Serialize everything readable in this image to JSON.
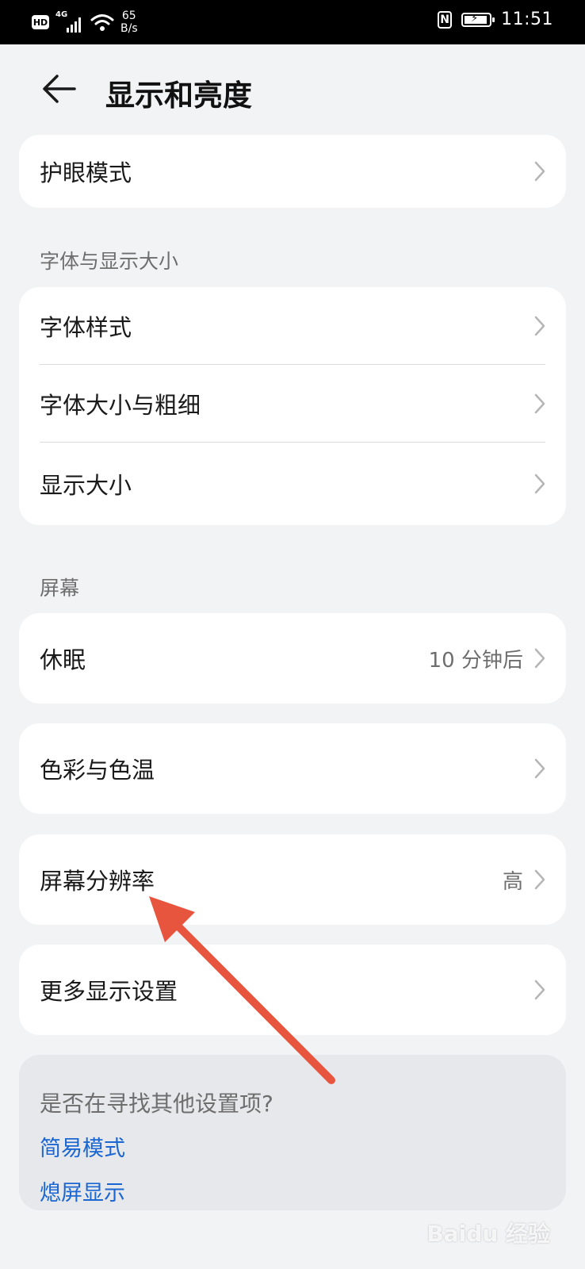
{
  "status_bar": {
    "hd": "HD",
    "network": "4G",
    "speed_value": "65",
    "speed_unit": "B/s",
    "nfc": "N",
    "time": "11:51"
  },
  "header": {
    "title": "显示和亮度"
  },
  "eye_card": {
    "label": "护眼模式"
  },
  "font_section": {
    "title": "字体与显示大小",
    "items": [
      {
        "label": "字体样式"
      },
      {
        "label": "字体大小与粗细"
      },
      {
        "label": "显示大小"
      }
    ]
  },
  "screen_section": {
    "title": "屏幕",
    "sleep": {
      "label": "休眠",
      "value": "10 分钟后"
    },
    "color": {
      "label": "色彩与色温"
    },
    "resolution": {
      "label": "屏幕分辨率",
      "value": "高"
    },
    "more": {
      "label": "更多显示设置"
    }
  },
  "suggest": {
    "question": "是否在寻找其他设置项?",
    "links": [
      "简易模式",
      "熄屏显示"
    ]
  },
  "watermark": "Baidu 经验",
  "colors": {
    "link": "#1a66d2",
    "arrow": "#e8553f",
    "background": "#f1f3f5"
  }
}
